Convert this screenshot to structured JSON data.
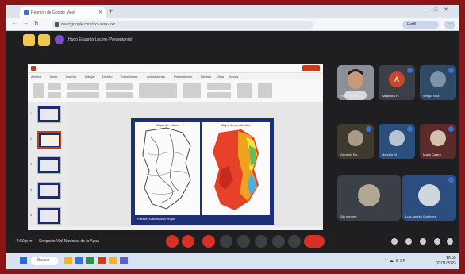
{
  "browser": {
    "tab_title": "Reunión de Google Meet",
    "url": "meet.google.com/xxx-xxxx-xxx",
    "profile_label": "Perfil",
    "menu_label": "⋯"
  },
  "meet": {
    "presenter_banner": "Hugo Eduardo Lucero (Presentando)",
    "meeting_time": "4:59 p.m.",
    "meeting_title": "Simposio Vial Nacional de la Agua",
    "participants": [
      {
        "name": "Hugo Eduardo",
        "initial": "",
        "color": "#6a6f78"
      },
      {
        "name": "Alejandra R.",
        "initial": "A",
        "color": "#c8462a"
      },
      {
        "name": "Sergio Vela",
        "initial": "",
        "color": "#2f4a66"
      },
      {
        "name": "Gerardo Ru...",
        "initial": "",
        "color": "#3f3a2e"
      },
      {
        "name": "Marcelo M...",
        "initial": "",
        "color": "#2a4f7a"
      },
      {
        "name": "Mario Castro",
        "initial": "",
        "color": "#5b2b2b"
      },
      {
        "name": "Sin nombre",
        "initial": "",
        "color": "#3b3f47"
      },
      {
        "name": "Luis Andrés Gutiérrez",
        "initial": "",
        "color": "#2b4e7e"
      }
    ]
  },
  "ppt": {
    "tabs": [
      "Archivo",
      "Inicio",
      "Insertar",
      "Dibujar",
      "Diseño",
      "Transiciones",
      "Animaciones",
      "Presentación",
      "Revisar",
      "Vista",
      "Ayuda"
    ],
    "slide_numbers": [
      "1",
      "2",
      "3",
      "4",
      "5"
    ],
    "slide": {
      "left_map_title": "Mapa de relieve",
      "right_map_title": "Mapa de pendientes",
      "caption": "Fuente: Elaboración propia"
    }
  },
  "taskbar": {
    "search_placeholder": "Buscar",
    "tray": "^ ☁ ESP",
    "time": "16:59",
    "date": "22/11/2023"
  },
  "colors": {
    "accent_red": "#d93025",
    "meet_bg": "#1f1f22",
    "slide_navy": "#1b2f7a",
    "frame": "#8c1414"
  }
}
